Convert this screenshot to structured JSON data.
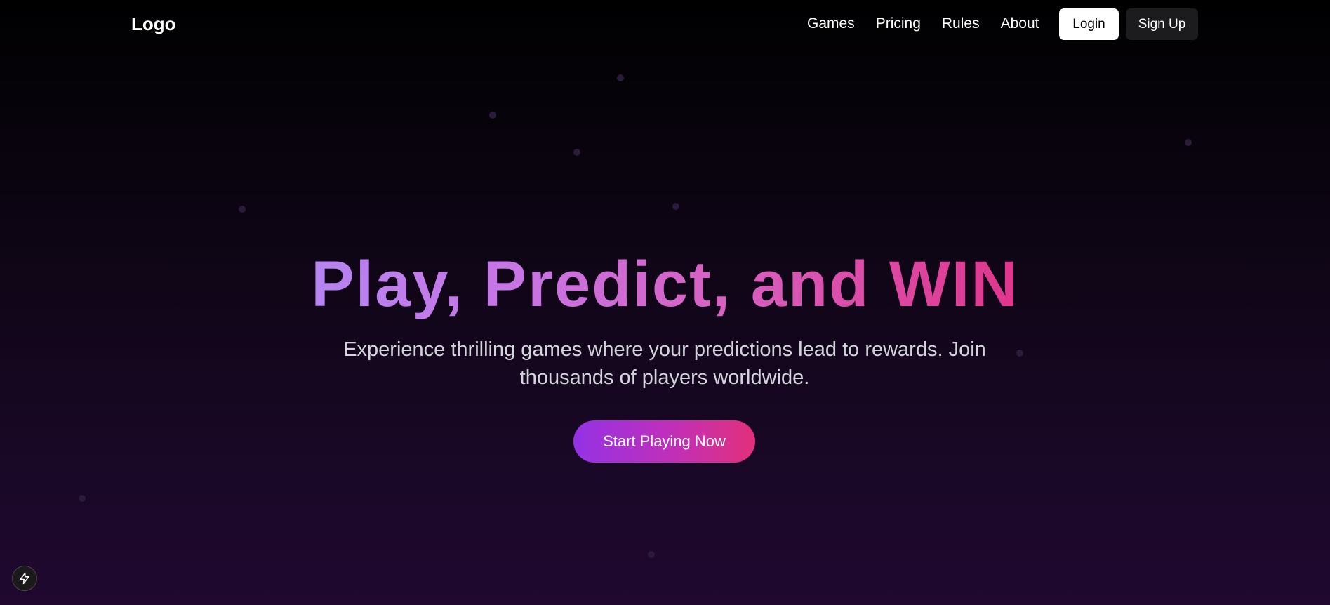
{
  "nav": {
    "logo": "Logo",
    "links": [
      "Games",
      "Pricing",
      "Rules",
      "About"
    ],
    "login_label": "Login",
    "signup_label": "Sign Up"
  },
  "hero": {
    "title": "Play, Predict, and WIN",
    "subtitle": "Experience thrilling games where your predictions lead to rewards. Join thousands of players worldwide.",
    "cta_label": "Start Playing Now"
  },
  "floating_icon": "lightning-bolt-icon",
  "colors": {
    "accent_purple": "#9432e6",
    "accent_pink": "#e2307a",
    "background_top": "#000000",
    "background_bottom": "#20082f"
  }
}
